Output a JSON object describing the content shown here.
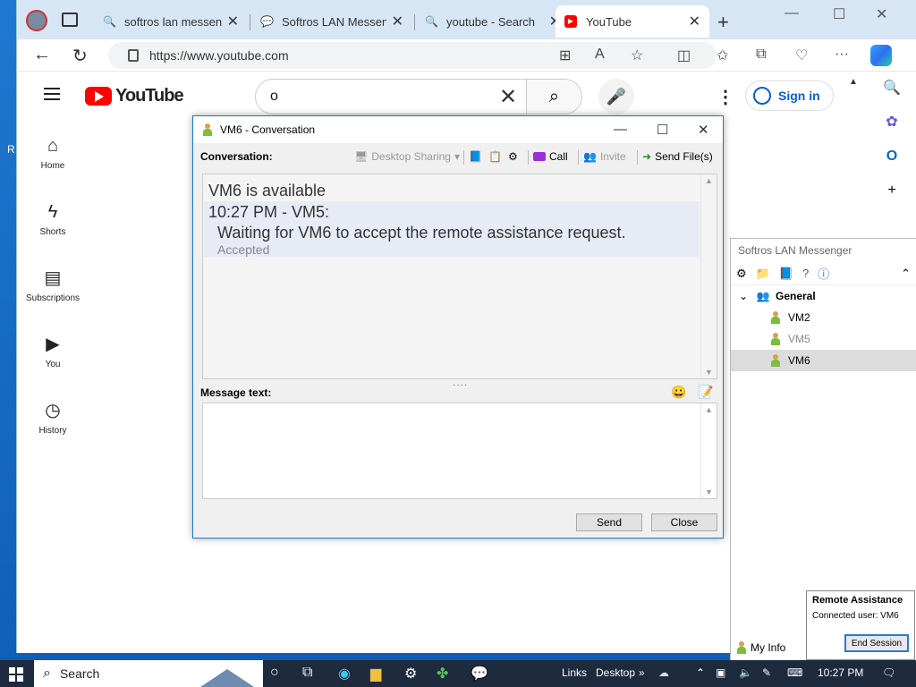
{
  "browser": {
    "tabs": [
      {
        "title": "softros lan messenger - Search"
      },
      {
        "title": "Softros LAN Messenger"
      },
      {
        "title": "youtube - Search"
      },
      {
        "title": "YouTube"
      }
    ],
    "url": "https://www.youtube.com"
  },
  "youtube": {
    "logo_text": "YouTube",
    "search_value": "o",
    "sign_in": "Sign in",
    "sidebar": [
      {
        "label": "Home"
      },
      {
        "label": "Shorts"
      },
      {
        "label": "Subscriptions"
      },
      {
        "label": "You"
      },
      {
        "label": "History"
      }
    ]
  },
  "conversation": {
    "title": "VM6 - Conversation",
    "label": "Conversation:",
    "toolbar": {
      "desktop_sharing": "Desktop Sharing",
      "call": "Call",
      "invite": "Invite",
      "send_files": "Send File(s)"
    },
    "history": {
      "status": "VM6 is available",
      "header": "10:27 PM - VM5:",
      "message": "Waiting for VM6 to accept the remote assistance request.",
      "note": "Accepted"
    },
    "message_label": "Message text:",
    "send": "Send",
    "close": "Close"
  },
  "messenger": {
    "title": "Softros LAN Messenger",
    "group": "General",
    "users": [
      "VM2",
      "VM5",
      "VM6"
    ],
    "my_info": "My Info"
  },
  "remote_assistance": {
    "title": "Remote Assistance",
    "connected": "Connected user: VM6",
    "end_session": "End Session"
  },
  "taskbar": {
    "search": "Search",
    "links": "Links",
    "desktop": "Desktop",
    "time": "10:27 PM"
  },
  "desktop_letter": "R"
}
